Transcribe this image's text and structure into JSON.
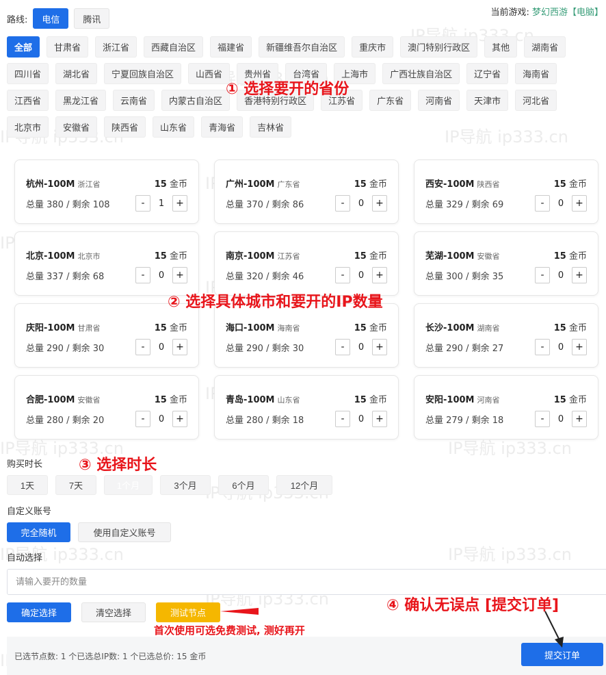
{
  "route": {
    "label": "路线:",
    "options": [
      "电信",
      "腾讯"
    ],
    "selected": "电信"
  },
  "current_game": {
    "label": "当前游戏:",
    "value": "梦幻西游【电脑】"
  },
  "provinces": {
    "rows": [
      [
        "全部",
        "甘肃省",
        "浙江省",
        "西藏自治区",
        "福建省",
        "新疆维吾尔自治区",
        "重庆市",
        "澳门特别行政区",
        "其他",
        "湖南省"
      ],
      [
        "四川省",
        "湖北省",
        "宁夏回族自治区",
        "山西省",
        "贵州省",
        "台湾省",
        "上海市",
        "广西壮族自治区",
        "辽宁省",
        "海南省"
      ],
      [
        "江西省",
        "黑龙江省",
        "云南省",
        "内蒙古自治区",
        "香港特别行政区",
        "江苏省",
        "广东省",
        "河南省",
        "天津市",
        "河北省"
      ],
      [
        "北京市",
        "安徽省",
        "陕西省",
        "山东省",
        "青海省",
        "吉林省"
      ]
    ],
    "selected": "全部"
  },
  "cards": [
    {
      "city": "杭州-100M",
      "province": "浙江省",
      "price_num": "15",
      "price_unit": "金币",
      "stock": "总量 380 / 剩余 108",
      "qty": "1"
    },
    {
      "city": "广州-100M",
      "province": "广东省",
      "price_num": "15",
      "price_unit": "金币",
      "stock": "总量 370 / 剩余 86",
      "qty": "0"
    },
    {
      "city": "西安-100M",
      "province": "陕西省",
      "price_num": "15",
      "price_unit": "金币",
      "stock": "总量 329 / 剩余 69",
      "qty": "0"
    },
    {
      "city": "北京-100M",
      "province": "北京市",
      "price_num": "15",
      "price_unit": "金币",
      "stock": "总量 337 / 剩余 68",
      "qty": "0"
    },
    {
      "city": "南京-100M",
      "province": "江苏省",
      "price_num": "15",
      "price_unit": "金币",
      "stock": "总量 320 / 剩余 46",
      "qty": "0"
    },
    {
      "city": "芜湖-100M",
      "province": "安徽省",
      "price_num": "15",
      "price_unit": "金币",
      "stock": "总量 300 / 剩余 35",
      "qty": "0"
    },
    {
      "city": "庆阳-100M",
      "province": "甘肃省",
      "price_num": "15",
      "price_unit": "金币",
      "stock": "总量 290 / 剩余 30",
      "qty": "0"
    },
    {
      "city": "海口-100M",
      "province": "海南省",
      "price_num": "15",
      "price_unit": "金币",
      "stock": "总量 290 / 剩余 30",
      "qty": "0"
    },
    {
      "city": "长沙-100M",
      "province": "湖南省",
      "price_num": "15",
      "price_unit": "金币",
      "stock": "总量 290 / 剩余 27",
      "qty": "0"
    },
    {
      "city": "合肥-100M",
      "province": "安徽省",
      "price_num": "15",
      "price_unit": "金币",
      "stock": "总量 280 / 剩余 20",
      "qty": "0"
    },
    {
      "city": "青岛-100M",
      "province": "山东省",
      "price_num": "15",
      "price_unit": "金币",
      "stock": "总量 280 / 剩余 18",
      "qty": "0"
    },
    {
      "city": "安阳-100M",
      "province": "河南省",
      "price_num": "15",
      "price_unit": "金币",
      "stock": "总量 279 / 剩余 18",
      "qty": "0"
    }
  ],
  "stepper": {
    "minus": "-",
    "plus": "+"
  },
  "duration": {
    "label": "购买时长",
    "options": [
      "1天",
      "7天",
      "1个月",
      "3个月",
      "6个月",
      "12个月"
    ],
    "selected": "1个月"
  },
  "account": {
    "label": "自定义账号",
    "options": [
      "完全随机",
      "使用自定义账号"
    ],
    "selected": "完全随机"
  },
  "auto_select": {
    "label": "自动选择",
    "placeholder": "请输入要开的数量"
  },
  "actions": {
    "confirm": "确定选择",
    "clear": "清空选择",
    "test": "测试节点"
  },
  "summary": {
    "text": "已选节点数: 1 个已选总IP数: 1 个已选总价: 15 金币",
    "submit": "提交订单"
  },
  "annotations": {
    "a1": "① 选择要开的省份",
    "a2": "② 选择具体城市和要开的IP数量",
    "a3": "③ 选择时长",
    "a4": "④ 确认无误点 [提交订单]",
    "a5": "首次使用可选免费测试, 测好再开"
  },
  "watermark": "IP导航  ip333.cn",
  "colors": {
    "primary": "#1e6ee8",
    "warning": "#f5b700",
    "annotation": "#e8151b",
    "game": "#3a9e7a"
  }
}
